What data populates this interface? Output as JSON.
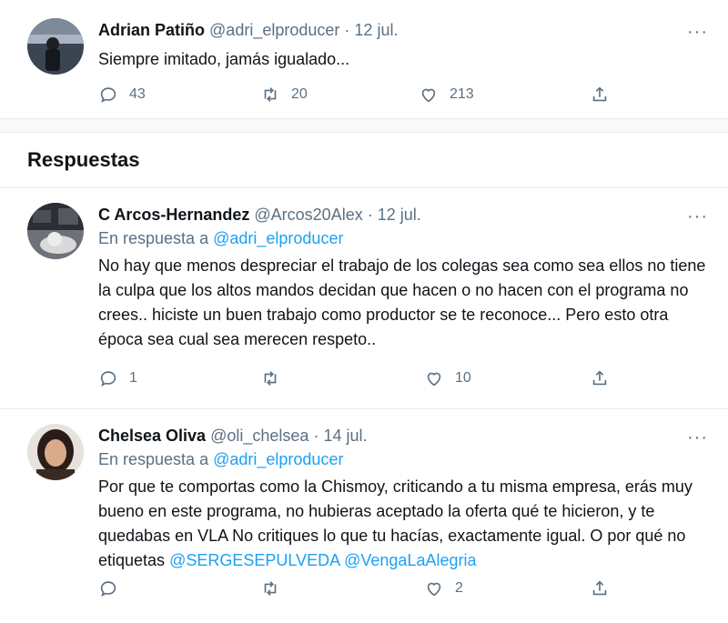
{
  "main_tweet": {
    "name": "Adrian Patiño",
    "handle": "@adri_elproducer",
    "separator": "·",
    "date": "12 jul.",
    "text": "Siempre imitado, jamás igualado...",
    "more": "···",
    "reply_count": "43",
    "retweet_count": "20",
    "like_count": "213"
  },
  "section": {
    "title": "Respuestas"
  },
  "replies": [
    {
      "name": "C Arcos-Hernandez",
      "handle": "@Arcos20Alex",
      "separator": "·",
      "date": "12 jul.",
      "reply_prefix": "En respuesta a",
      "reply_to": "@adri_elproducer",
      "text": "No hay que menos despreciar el trabajo de los colegas sea como sea ellos no tiene la culpa que los altos mandos decidan que hacen o no hacen con el programa no crees.. hiciste un buen trabajo como productor se te reconoce... Pero esto otra época sea cual sea merecen respeto..",
      "more": "···",
      "reply_count": "1",
      "retweet_count": "",
      "like_count": "10"
    },
    {
      "name": "Chelsea Oliva",
      "handle": "@oli_chelsea",
      "separator": "·",
      "date": "14 jul.",
      "reply_prefix": "En respuesta a",
      "reply_to": "@adri_elproducer",
      "text": "Por que te comportas como la Chismoy, criticando a tu misma empresa, erás muy bueno en este programa, no hubieras aceptado la oferta qué te hicieron, y te quedabas en VLA No critiques lo que tu hacías, exactamente igual. O por qué no etiquetas",
      "mention_1": "@SERGESEPULVEDA",
      "mention_2": "@VengaLaAlegria",
      "more": "···",
      "reply_count": "",
      "retweet_count": "",
      "like_count": "2"
    }
  ],
  "icons": {
    "reply": "comment-icon",
    "retweet": "retweet-icon",
    "like": "heart-icon",
    "share": "share-icon",
    "more": "more-icon"
  },
  "colors": {
    "link": "#1da1f2",
    "muted": "#5b7083",
    "text": "#0f1419"
  }
}
